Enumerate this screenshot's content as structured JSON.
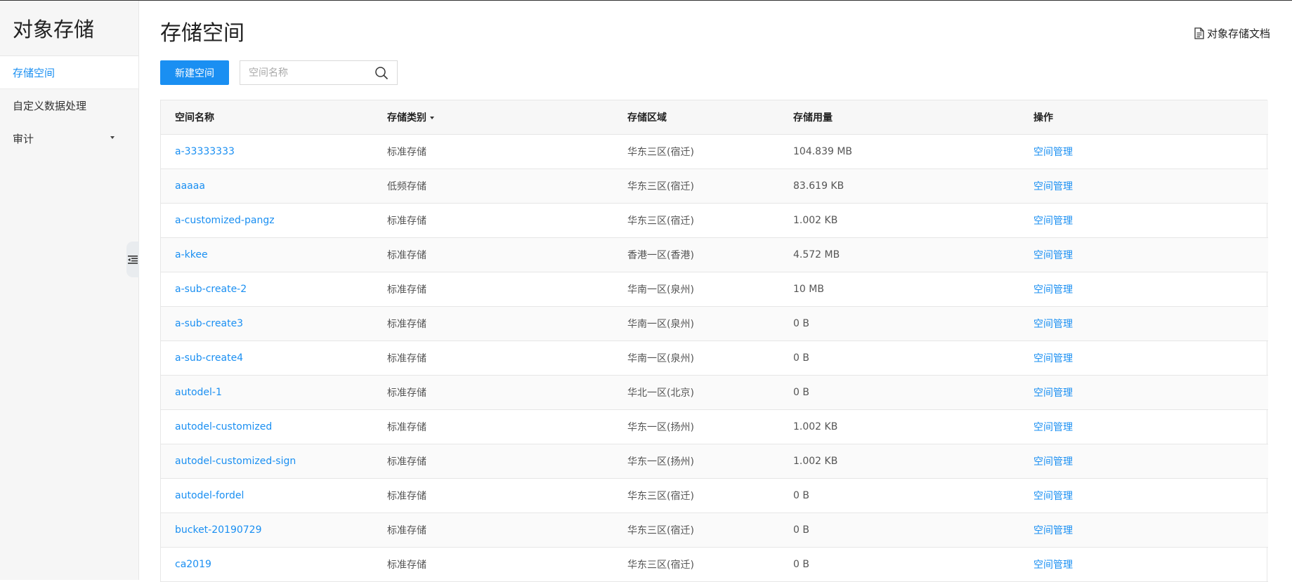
{
  "sidebar": {
    "brand": "对象存储",
    "items": [
      {
        "label": "存储空间"
      },
      {
        "label": "自定义数据处理"
      },
      {
        "label": "审计"
      }
    ]
  },
  "header": {
    "title": "存储空间",
    "doc_link": "对象存储文档"
  },
  "toolbar": {
    "new_button": "新建空间",
    "search_placeholder": "空间名称"
  },
  "table": {
    "columns": [
      "空间名称",
      "存储类别",
      "存储区域",
      "存储用量",
      "操作"
    ],
    "rows": [
      {
        "name": "a-33333333",
        "class": "标准存储",
        "region": "华东三区(宿迁)",
        "usage": "104.839 MB",
        "action": "空间管理"
      },
      {
        "name": "aaaaa",
        "class": "低频存储",
        "region": "华东三区(宿迁)",
        "usage": "83.619 KB",
        "action": "空间管理"
      },
      {
        "name": "a-customized-pangz",
        "class": "标准存储",
        "region": "华东三区(宿迁)",
        "usage": "1.002 KB",
        "action": "空间管理"
      },
      {
        "name": "a-kkee",
        "class": "标准存储",
        "region": "香港一区(香港)",
        "usage": "4.572 MB",
        "action": "空间管理"
      },
      {
        "name": "a-sub-create-2",
        "class": "标准存储",
        "region": "华南一区(泉州)",
        "usage": "10 MB",
        "action": "空间管理"
      },
      {
        "name": "a-sub-create3",
        "class": "标准存储",
        "region": "华南一区(泉州)",
        "usage": "0 B",
        "action": "空间管理"
      },
      {
        "name": "a-sub-create4",
        "class": "标准存储",
        "region": "华南一区(泉州)",
        "usage": "0 B",
        "action": "空间管理"
      },
      {
        "name": "autodel-1",
        "class": "标准存储",
        "region": "华北一区(北京)",
        "usage": "0 B",
        "action": "空间管理"
      },
      {
        "name": "autodel-customized",
        "class": "标准存储",
        "region": "华东一区(扬州)",
        "usage": "1.002 KB",
        "action": "空间管理"
      },
      {
        "name": "autodel-customized-sign",
        "class": "标准存储",
        "region": "华东一区(扬州)",
        "usage": "1.002 KB",
        "action": "空间管理"
      },
      {
        "name": "autodel-fordel",
        "class": "标准存储",
        "region": "华东三区(宿迁)",
        "usage": "0 B",
        "action": "空间管理"
      },
      {
        "name": "bucket-20190729",
        "class": "标准存储",
        "region": "华东三区(宿迁)",
        "usage": "0 B",
        "action": "空间管理"
      },
      {
        "name": "ca2019",
        "class": "标准存储",
        "region": "华东三区(宿迁)",
        "usage": "0 B",
        "action": "空间管理"
      }
    ]
  },
  "colors": {
    "accent": "#1a8ff2",
    "sidebar_bg": "#f6f6f6",
    "header_row_bg": "#f7f7f7"
  },
  "icons": {
    "doc": "document-icon",
    "search": "search-icon",
    "collapse": "collapse-sidebar-icon",
    "sort": "sort-caret-icon",
    "expand": "caret-down-icon"
  }
}
